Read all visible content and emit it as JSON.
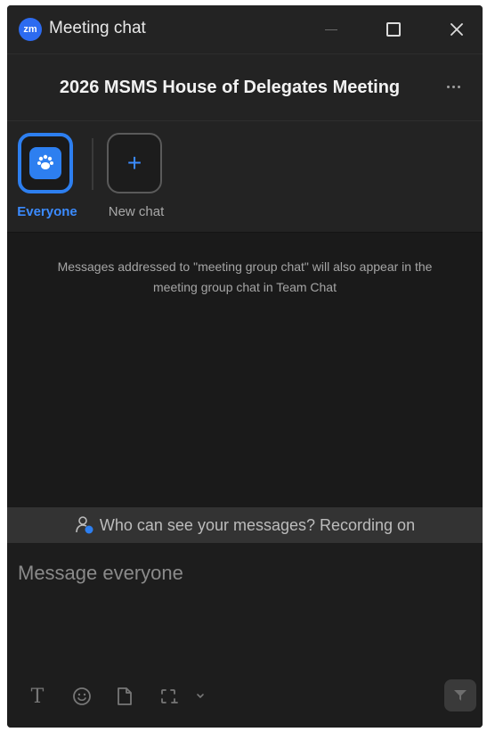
{
  "window": {
    "app_logo_text": "zm",
    "title": "Meeting chat",
    "buttons": {
      "minimize_icon": "minimize-icon",
      "maximize_icon": "maximize-icon",
      "close_icon": "close-icon"
    }
  },
  "header": {
    "meeting_title": "2026 MSMS House of Delegates Meeting",
    "more_icon": "more-options-icon"
  },
  "recipients": [
    {
      "label": "Everyone",
      "icon": "paw-icon",
      "selected": true
    },
    {
      "label": "New chat",
      "icon": "plus-icon",
      "selected": false
    }
  ],
  "messages": {
    "notice": "Messages addressed to \"meeting group chat\" will also appear in the meeting group chat in Team Chat"
  },
  "visibility": {
    "text": "Who can see your messages? Recording on",
    "icon": "person-visibility-icon"
  },
  "compose": {
    "placeholder": "Message everyone",
    "value": "",
    "toolbar": {
      "text_format_icon": "text-format-icon",
      "text_format_glyph": "T",
      "emoji_icon": "emoji-icon",
      "file_icon": "file-icon",
      "screenshot_icon": "screenshot-icon",
      "more_icon": "chevron-down-icon",
      "send_icon": "send-icon"
    }
  },
  "colors": {
    "accent": "#2d7ff0",
    "window_bg": "#1a1a1a",
    "panel_bg": "#232323"
  }
}
